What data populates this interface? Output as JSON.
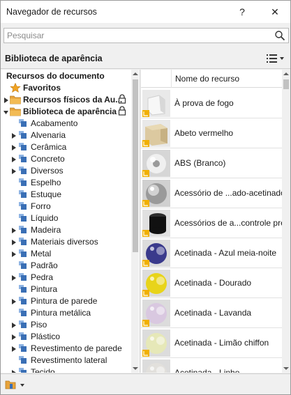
{
  "window": {
    "title": "Navegador de recursos",
    "help_label": "?",
    "close_label": "✕"
  },
  "search": {
    "placeholder": "Pesquisar",
    "value": ""
  },
  "section": {
    "title": "Biblioteca de aparência"
  },
  "tree": {
    "items": [
      {
        "label": "Recursos do documento",
        "level": 0,
        "icon": "none",
        "arrow": "none",
        "bold": true
      },
      {
        "label": "Favoritos",
        "level": 0,
        "icon": "star-icon",
        "arrow": "none",
        "bold": true
      },
      {
        "label": "Recursos físicos da Au...",
        "level": 0,
        "icon": "folder-icon",
        "arrow": "collapsed",
        "bold": true,
        "locked": true
      },
      {
        "label": "Biblioteca de aparência",
        "level": 0,
        "icon": "folder-icon",
        "arrow": "expanded",
        "bold": true,
        "locked": true
      },
      {
        "label": "Acabamento",
        "level": 1,
        "icon": "category-icon",
        "arrow": "none"
      },
      {
        "label": "Alvenaria",
        "level": 1,
        "icon": "category-icon",
        "arrow": "collapsed"
      },
      {
        "label": "Cerâmica",
        "level": 1,
        "icon": "category-icon",
        "arrow": "collapsed"
      },
      {
        "label": "Concreto",
        "level": 1,
        "icon": "category-icon",
        "arrow": "collapsed"
      },
      {
        "label": "Diversos",
        "level": 1,
        "icon": "category-icon",
        "arrow": "collapsed"
      },
      {
        "label": "Espelho",
        "level": 1,
        "icon": "category-icon",
        "arrow": "none"
      },
      {
        "label": "Estuque",
        "level": 1,
        "icon": "category-icon",
        "arrow": "none"
      },
      {
        "label": "Forro",
        "level": 1,
        "icon": "category-icon",
        "arrow": "none"
      },
      {
        "label": "Líquido",
        "level": 1,
        "icon": "category-icon",
        "arrow": "none"
      },
      {
        "label": "Madeira",
        "level": 1,
        "icon": "category-icon",
        "arrow": "collapsed"
      },
      {
        "label": "Materiais diversos",
        "level": 1,
        "icon": "category-icon",
        "arrow": "collapsed"
      },
      {
        "label": "Metal",
        "level": 1,
        "icon": "category-icon",
        "arrow": "collapsed"
      },
      {
        "label": "Padrão",
        "level": 1,
        "icon": "category-icon",
        "arrow": "none"
      },
      {
        "label": "Pedra",
        "level": 1,
        "icon": "category-icon",
        "arrow": "collapsed"
      },
      {
        "label": "Pintura",
        "level": 1,
        "icon": "category-icon",
        "arrow": "none"
      },
      {
        "label": "Pintura de parede",
        "level": 1,
        "icon": "category-icon",
        "arrow": "collapsed"
      },
      {
        "label": "Pintura metálica",
        "level": 1,
        "icon": "category-icon",
        "arrow": "none"
      },
      {
        "label": "Piso",
        "level": 1,
        "icon": "category-icon",
        "arrow": "collapsed"
      },
      {
        "label": "Plástico",
        "level": 1,
        "icon": "category-icon",
        "arrow": "collapsed"
      },
      {
        "label": "Revestimento de parede",
        "level": 1,
        "icon": "category-icon",
        "arrow": "collapsed"
      },
      {
        "label": "Revestimento lateral",
        "level": 1,
        "icon": "category-icon",
        "arrow": "none"
      },
      {
        "label": "Tecido",
        "level": 1,
        "icon": "category-icon",
        "arrow": "collapsed"
      }
    ]
  },
  "resources": {
    "column_header": "Nome do recurso",
    "items": [
      {
        "name": "À prova de fogo",
        "thumb": "fireproof-thumb",
        "color": "#d9d9d9"
      },
      {
        "name": "Abeto vermelho",
        "thumb": "wood-cube-thumb",
        "color": "#dcc9a0"
      },
      {
        "name": "ABS (Branco)",
        "thumb": "white-torus-thumb",
        "color": "#c8c8c8"
      },
      {
        "name": "Acessório de ...ado-acetinado",
        "thumb": "metal-sphere-thumb",
        "color": "#b5b5b5"
      },
      {
        "name": "Acessórios de a...controle preto",
        "thumb": "black-cylinder-thumb",
        "color": "#1a1a1a"
      },
      {
        "name": "Acetinada - Azul meia-noite",
        "thumb": "blue-ball-thumb",
        "color": "#3a3a8c"
      },
      {
        "name": "Acetinada - Dourado",
        "thumb": "yellow-ball-thumb",
        "color": "#e8d41a"
      },
      {
        "name": "Acetinada - Lavanda",
        "thumb": "lavender-ball-thumb",
        "color": "#d9c8e0"
      },
      {
        "name": "Acetinada - Limão chiffon",
        "thumb": "lemon-ball-thumb",
        "color": "#e6e8b8"
      },
      {
        "name": "Acetinada - Linho",
        "thumb": "linen-ball-thumb",
        "color": "#e2e0dc"
      }
    ]
  },
  "colors": {
    "folder": "#e8a33a",
    "star": "#f0a323",
    "category_blue": "#3a6fb5",
    "library_badge": "#f0b000"
  }
}
